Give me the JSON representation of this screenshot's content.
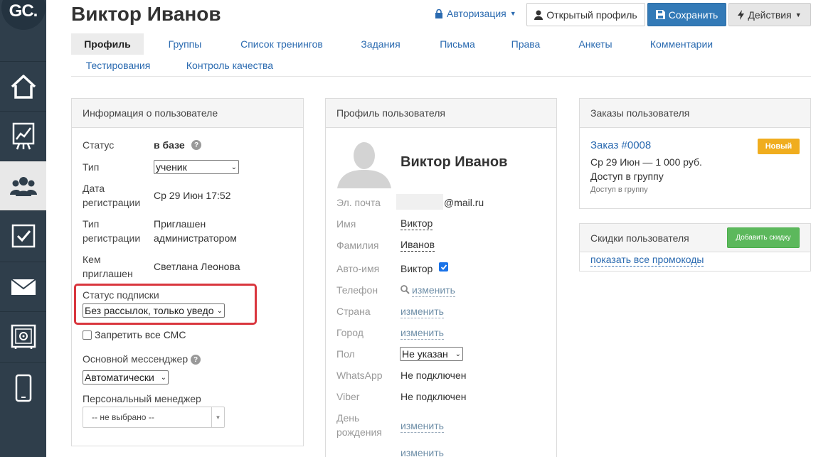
{
  "logo": {
    "text": "GC",
    "dot": "."
  },
  "sidebar": {
    "items": [
      {
        "name": "home-icon"
      },
      {
        "name": "chart-icon"
      },
      {
        "name": "users-icon",
        "active": true
      },
      {
        "name": "checkbox-icon"
      },
      {
        "name": "mail-icon"
      },
      {
        "name": "safe-icon"
      },
      {
        "name": "phone-icon"
      }
    ]
  },
  "header": {
    "title": "Виктор Иванов",
    "auth_label": "Авторизация",
    "profile_button": "Открытый профиль",
    "save_button": "Сохранить",
    "actions_button": "Действия"
  },
  "tabs": [
    {
      "label": "Профиль",
      "active": true
    },
    {
      "label": "Группы"
    },
    {
      "label": "Список тренингов"
    },
    {
      "label": "Задания"
    },
    {
      "label": "Письма"
    },
    {
      "label": "Права"
    },
    {
      "label": "Анкеты"
    },
    {
      "label": "Комментарии"
    },
    {
      "label": "Тестирования"
    },
    {
      "label": "Контроль качества"
    }
  ],
  "user_info": {
    "title": "Информация о пользователе",
    "status_label": "Статус",
    "status_value": "в базе",
    "type_label": "Тип",
    "type_value": "ученик",
    "reg_date_label_1": "Дата",
    "reg_date_label_2": "регистрации",
    "reg_date_value": "Ср 29 Июн 17:52",
    "reg_type_label_1": "Тип",
    "reg_type_label_2": "регистрации",
    "reg_type_value_1": "Приглашен",
    "reg_type_value_2": "администратором",
    "invited_label_1": "Кем",
    "invited_label_2": "приглашен",
    "invited_value": "Светлана Леонова",
    "subscription_label": "Статус подписки",
    "subscription_value": "Без рассылок, только уведо",
    "sms_label": "Запретить все СМС",
    "messenger_label": "Основной мессенджер",
    "messenger_value": "Автоматически",
    "manager_label": "Персональный менеджер",
    "manager_value": "-- не выбрано --"
  },
  "profile": {
    "title": "Профиль пользователя",
    "name": "Виктор Иванов",
    "email_label": "Эл. почта",
    "email_value": "@mail.ru",
    "first_name_label": "Имя",
    "first_name_value": "Виктор",
    "last_name_label": "Фамилия",
    "last_name_value": "Иванов",
    "auto_name_label": "Авто-имя",
    "auto_name_value": "Виктор",
    "phone_label": "Телефон",
    "country_label": "Страна",
    "city_label": "Город",
    "gender_label": "Пол",
    "gender_value": "Не указан",
    "whatsapp_label": "WhatsApp",
    "whatsapp_value": "Не подключен",
    "viber_label": "Viber",
    "viber_value": "Не подключен",
    "birthday_label_1": "День",
    "birthday_label_2": "рождения",
    "change_link": "изменить"
  },
  "orders": {
    "title": "Заказы пользователя",
    "order_link": "Заказ #0008",
    "badge": "Новый",
    "order_line": "Ср 29 Июн — 1 000 руб.",
    "access_line": "Доступ в группу",
    "access_small": "Доступ в группу"
  },
  "discounts": {
    "title": "Скидки пользователя",
    "add_button": "Добавить скидку",
    "promo_link": "показать все промокоды"
  }
}
